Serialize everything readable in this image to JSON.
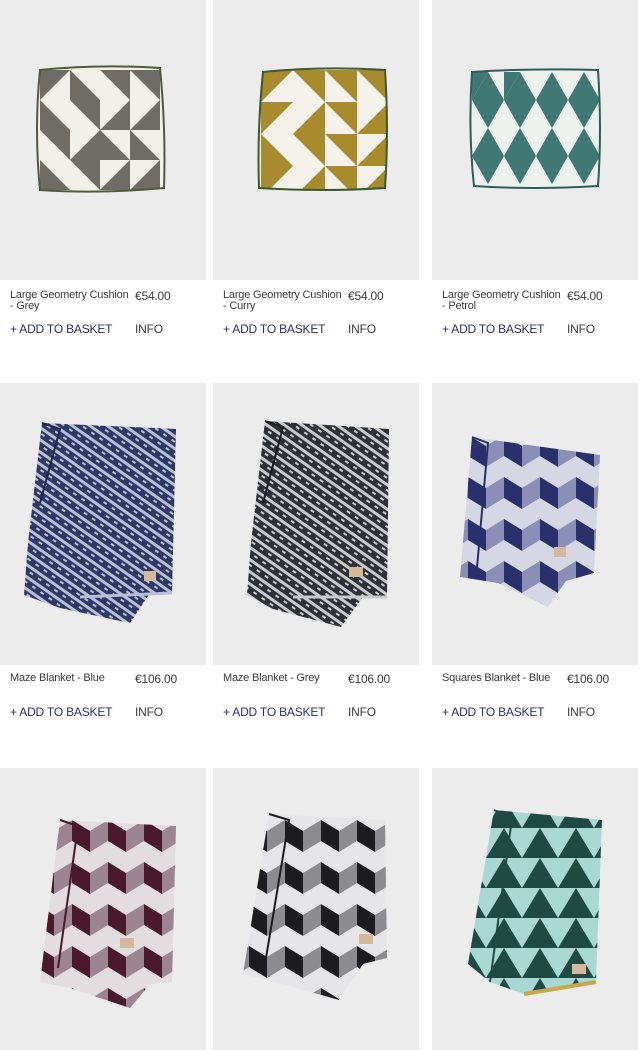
{
  "products": [
    {
      "name": "Large Geometry Cushion - Grey",
      "price": "€54.00",
      "add_label": "+ ADD TO BASKET",
      "info_label": "INFO",
      "image": "cushion-grey",
      "colors": {
        "main": "#6e6c64",
        "light": "#f1f0ea",
        "piping": "#4e5a3a"
      }
    },
    {
      "name": "Large Geometry Cushion - Curry",
      "price": "€54.00",
      "add_label": "+ ADD TO BASKET",
      "info_label": "INFO",
      "image": "cushion-curry",
      "colors": {
        "main": "#a88b2c",
        "light": "#f4f2ea",
        "piping": "#3d5a2d"
      }
    },
    {
      "name": "Large Geometry Cushion - Petrol",
      "price": "€54.00",
      "add_label": "+ ADD TO BASKET",
      "info_label": "INFO",
      "image": "cushion-petrol",
      "colors": {
        "main": "#3f7873",
        "light": "#eef2ef",
        "piping": "#2f5d58"
      }
    },
    {
      "name": "Maze Blanket - Blue",
      "price": "€106.00",
      "add_label": "+ ADD TO BASKET",
      "info_label": "INFO",
      "image": "blanket-maze-blue",
      "colors": {
        "main": "#2e3866",
        "light": "#b9bfd6"
      }
    },
    {
      "name": "Maze Blanket - Grey",
      "price": "€106.00",
      "add_label": "+ ADD TO BASKET",
      "info_label": "INFO",
      "image": "blanket-maze-grey",
      "colors": {
        "main": "#2f3035",
        "light": "#c9cacd"
      }
    },
    {
      "name": "Squares Blanket - Blue",
      "price": "€106.00",
      "add_label": "+ ADD TO BASKET",
      "info_label": "INFO",
      "image": "blanket-squares-blue",
      "colors": {
        "main": "#2b2f6b",
        "light": "#d6d7e4",
        "mid": "#8b8fb8"
      }
    },
    {
      "name": "",
      "price": "",
      "add_label": "",
      "info_label": "",
      "image": "blanket-squares-burgundy",
      "colors": {
        "main": "#4a1a2c",
        "light": "#e3dde0",
        "mid": "#9c8590"
      }
    },
    {
      "name": "",
      "price": "",
      "add_label": "",
      "info_label": "",
      "image": "blanket-squares-black",
      "colors": {
        "main": "#1d1d20",
        "light": "#e6e6e8",
        "mid": "#8c8c90"
      }
    },
    {
      "name": "",
      "price": "",
      "add_label": "",
      "info_label": "",
      "image": "blanket-triangles-green",
      "colors": {
        "main": "#1f4a44",
        "light": "#a9d8d3",
        "edge": "#c8a84a"
      }
    }
  ]
}
